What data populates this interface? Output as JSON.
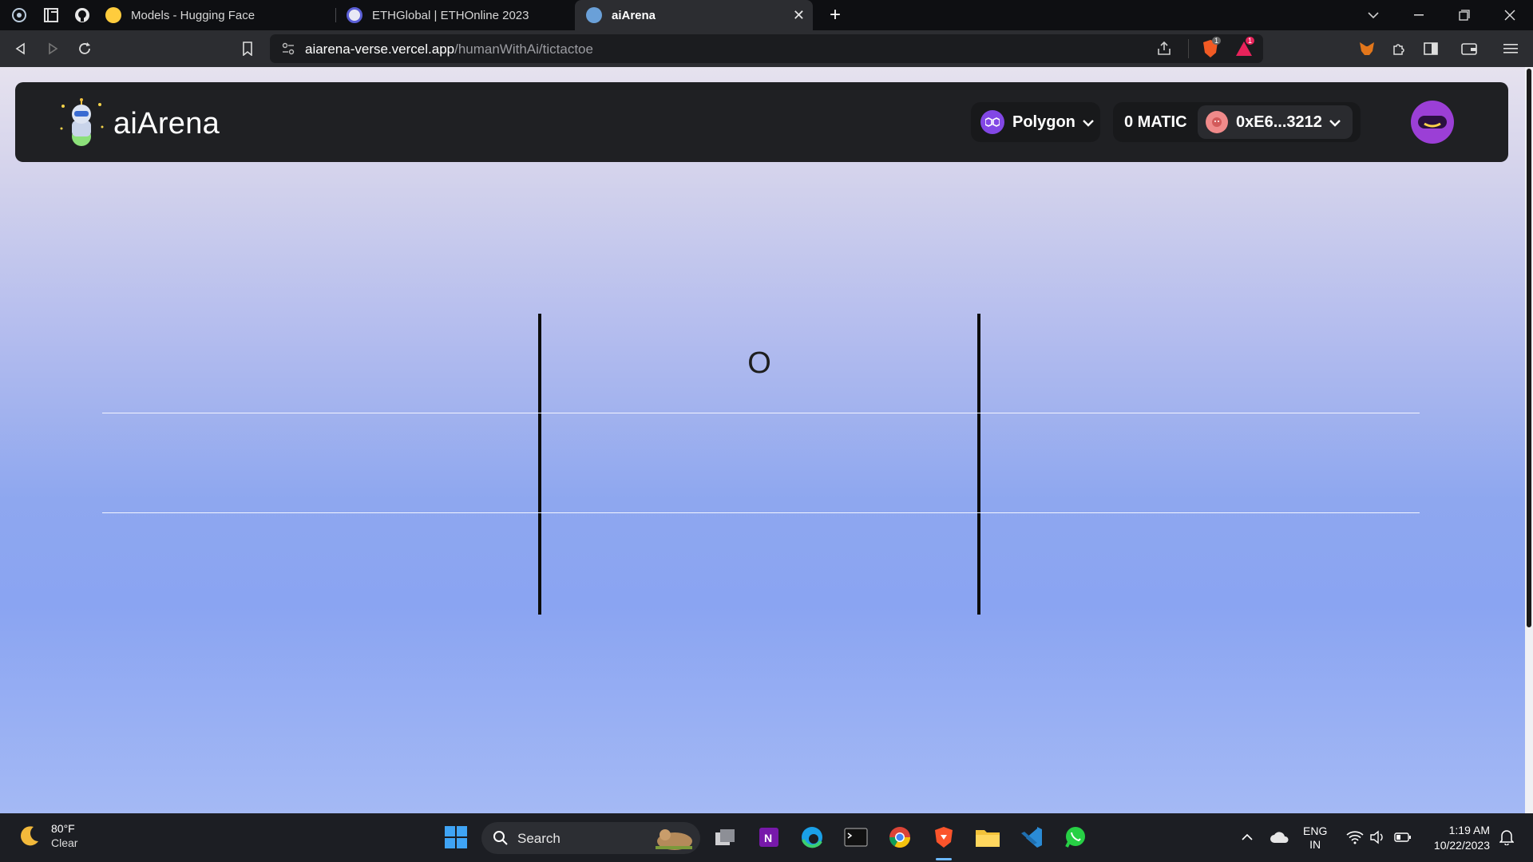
{
  "browser": {
    "tabs": [
      {
        "title": "Models - Hugging Face"
      },
      {
        "title": "ETHGlobal | ETHOnline 2023"
      },
      {
        "title": "aiArena",
        "active": true
      }
    ],
    "new_tab_symbol": "+",
    "close_symbol": "✕",
    "url": {
      "host": "aiarena-verse.vercel.app",
      "path": "/humanWithAi/tictactoe"
    },
    "pinned_icons": [
      "openai-icon",
      "notion-icon",
      "github-icon"
    ],
    "shield_badge": "1",
    "alert_badge": "1"
  },
  "app": {
    "brand": "aiArena",
    "network": {
      "label": "Polygon",
      "color": "#8247e5"
    },
    "balance": "0 MATIC",
    "account": "0xE6...3212",
    "accent": "#8a2be2"
  },
  "game": {
    "cells": [
      "",
      "O",
      "",
      "",
      "",
      "",
      "",
      "",
      ""
    ]
  },
  "taskbar": {
    "weather": {
      "temp": "80°F",
      "cond": "Clear"
    },
    "search_label": "Search",
    "lang": {
      "line1": "ENG",
      "line2": "IN"
    },
    "time": "1:19 AM",
    "date": "10/22/2023"
  }
}
